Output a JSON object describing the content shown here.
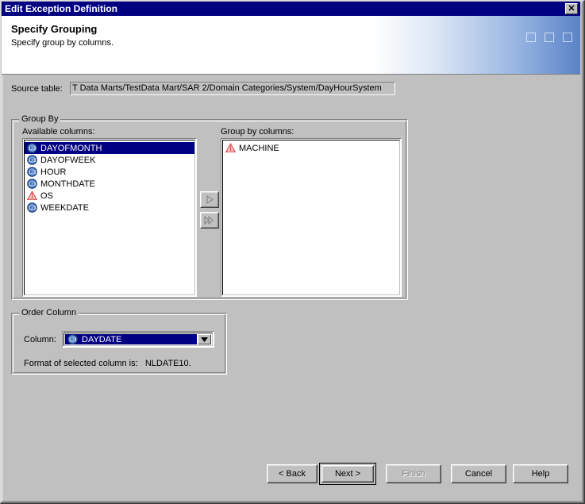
{
  "window": {
    "title": "Edit Exception Definition",
    "close_label": "✕"
  },
  "banner": {
    "title": "Specify Grouping",
    "subtitle": "Specify group by columns."
  },
  "source": {
    "label": "Source table:",
    "value": "T Data Marts/TestData Mart/SAR 2/Domain Categories/System/DayHourSystem"
  },
  "group_by": {
    "legend": "Group By",
    "available_label": "Available columns:",
    "groupby_label": "Group by columns:",
    "available_items": [
      {
        "name": "DAYOFMONTH",
        "icon": "numeric-column-icon",
        "selected": true
      },
      {
        "name": "DAYOFWEEK",
        "icon": "numeric-column-icon",
        "selected": false
      },
      {
        "name": "HOUR",
        "icon": "numeric-column-icon",
        "selected": false
      },
      {
        "name": "MONTHDATE",
        "icon": "numeric-column-icon",
        "selected": false
      },
      {
        "name": "OS",
        "icon": "attribute-column-icon",
        "selected": false
      },
      {
        "name": "WEEKDATE",
        "icon": "numeric-column-icon",
        "selected": false
      }
    ],
    "groupby_items": [
      {
        "name": "MACHINE",
        "icon": "attribute-column-icon",
        "selected": false
      }
    ],
    "transfer_one_label": "▶",
    "transfer_all_label": "▶▶"
  },
  "order_column": {
    "legend": "Order Column",
    "column_label": "Column:",
    "selected_value": "DAYDATE",
    "selected_icon": "numeric-column-icon",
    "format_text": "Format of selected column is:   NLDATE10."
  },
  "footer": {
    "back": "< Back",
    "next": "Next >",
    "finish": "Finish",
    "cancel": "Cancel",
    "help": "Help"
  },
  "colors": {
    "titlebar": "#000080",
    "selection": "#000080",
    "face": "#c0c0c0",
    "banner_accent": "#5a82c8",
    "attribute_icon": "#e05050",
    "numeric_icon": "#3a6bb5"
  }
}
